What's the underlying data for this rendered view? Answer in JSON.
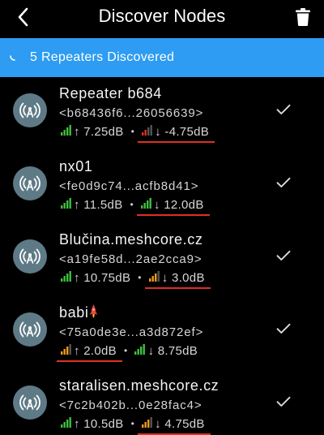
{
  "header": {
    "title": "Discover Nodes",
    "back_icon": "chevron-left-icon",
    "trash_icon": "trash-icon"
  },
  "banner": {
    "text": "5 Repeaters Discovered",
    "background": "#2d9cf2"
  },
  "colors": {
    "signal_green": "#3fbf3f",
    "signal_orange": "#f29a1a",
    "signal_red": "#e0301e",
    "signal_dim": "#555555",
    "annotation_underline": "#e0301e",
    "avatar_bg": "#5e7a86"
  },
  "nodes": [
    {
      "name": "Repeater b684",
      "emoji": "",
      "pubkey": "<b68436f6...26056639>",
      "up_snr": "↑ 7.25dB",
      "down_snr": "↓ -4.75dB",
      "up_level": 4,
      "up_color": "green",
      "down_level": 2,
      "down_color": "red",
      "underlined": "down"
    },
    {
      "name": "nx01",
      "emoji": "",
      "pubkey": "<fe0d9c74...acfb8d41>",
      "up_snr": "↑ 11.5dB",
      "down_snr": "↓ 12.0dB",
      "up_level": 4,
      "up_color": "green",
      "down_level": 4,
      "down_color": "green",
      "underlined": "down"
    },
    {
      "name": "Blučina.meshcore.cz",
      "emoji": "",
      "pubkey": "<a19fe58d...2ae2cca9>",
      "up_snr": "↑ 10.75dB",
      "down_snr": "↓ 3.0dB",
      "up_level": 4,
      "up_color": "green",
      "down_level": 3,
      "down_color": "orange",
      "underlined": "down"
    },
    {
      "name": "babi",
      "emoji": "rocket-icon",
      "pubkey": "<75a0de3e...a3d872ef>",
      "up_snr": "↑ 2.0dB",
      "down_snr": "↓ 8.75dB",
      "up_level": 3,
      "up_color": "orange",
      "down_level": 4,
      "down_color": "green",
      "underlined": "up"
    },
    {
      "name": "staralisen.meshcore.cz",
      "emoji": "",
      "pubkey": "<7c2b402b...0e28fac4>",
      "up_snr": "↑ 10.5dB",
      "down_snr": "↓ 4.75dB",
      "up_level": 4,
      "up_color": "green",
      "down_level": 3,
      "down_color": "orange",
      "underlined": "down"
    }
  ],
  "row_icons": {
    "avatar": "antenna-icon",
    "select": "checkmark-icon"
  }
}
